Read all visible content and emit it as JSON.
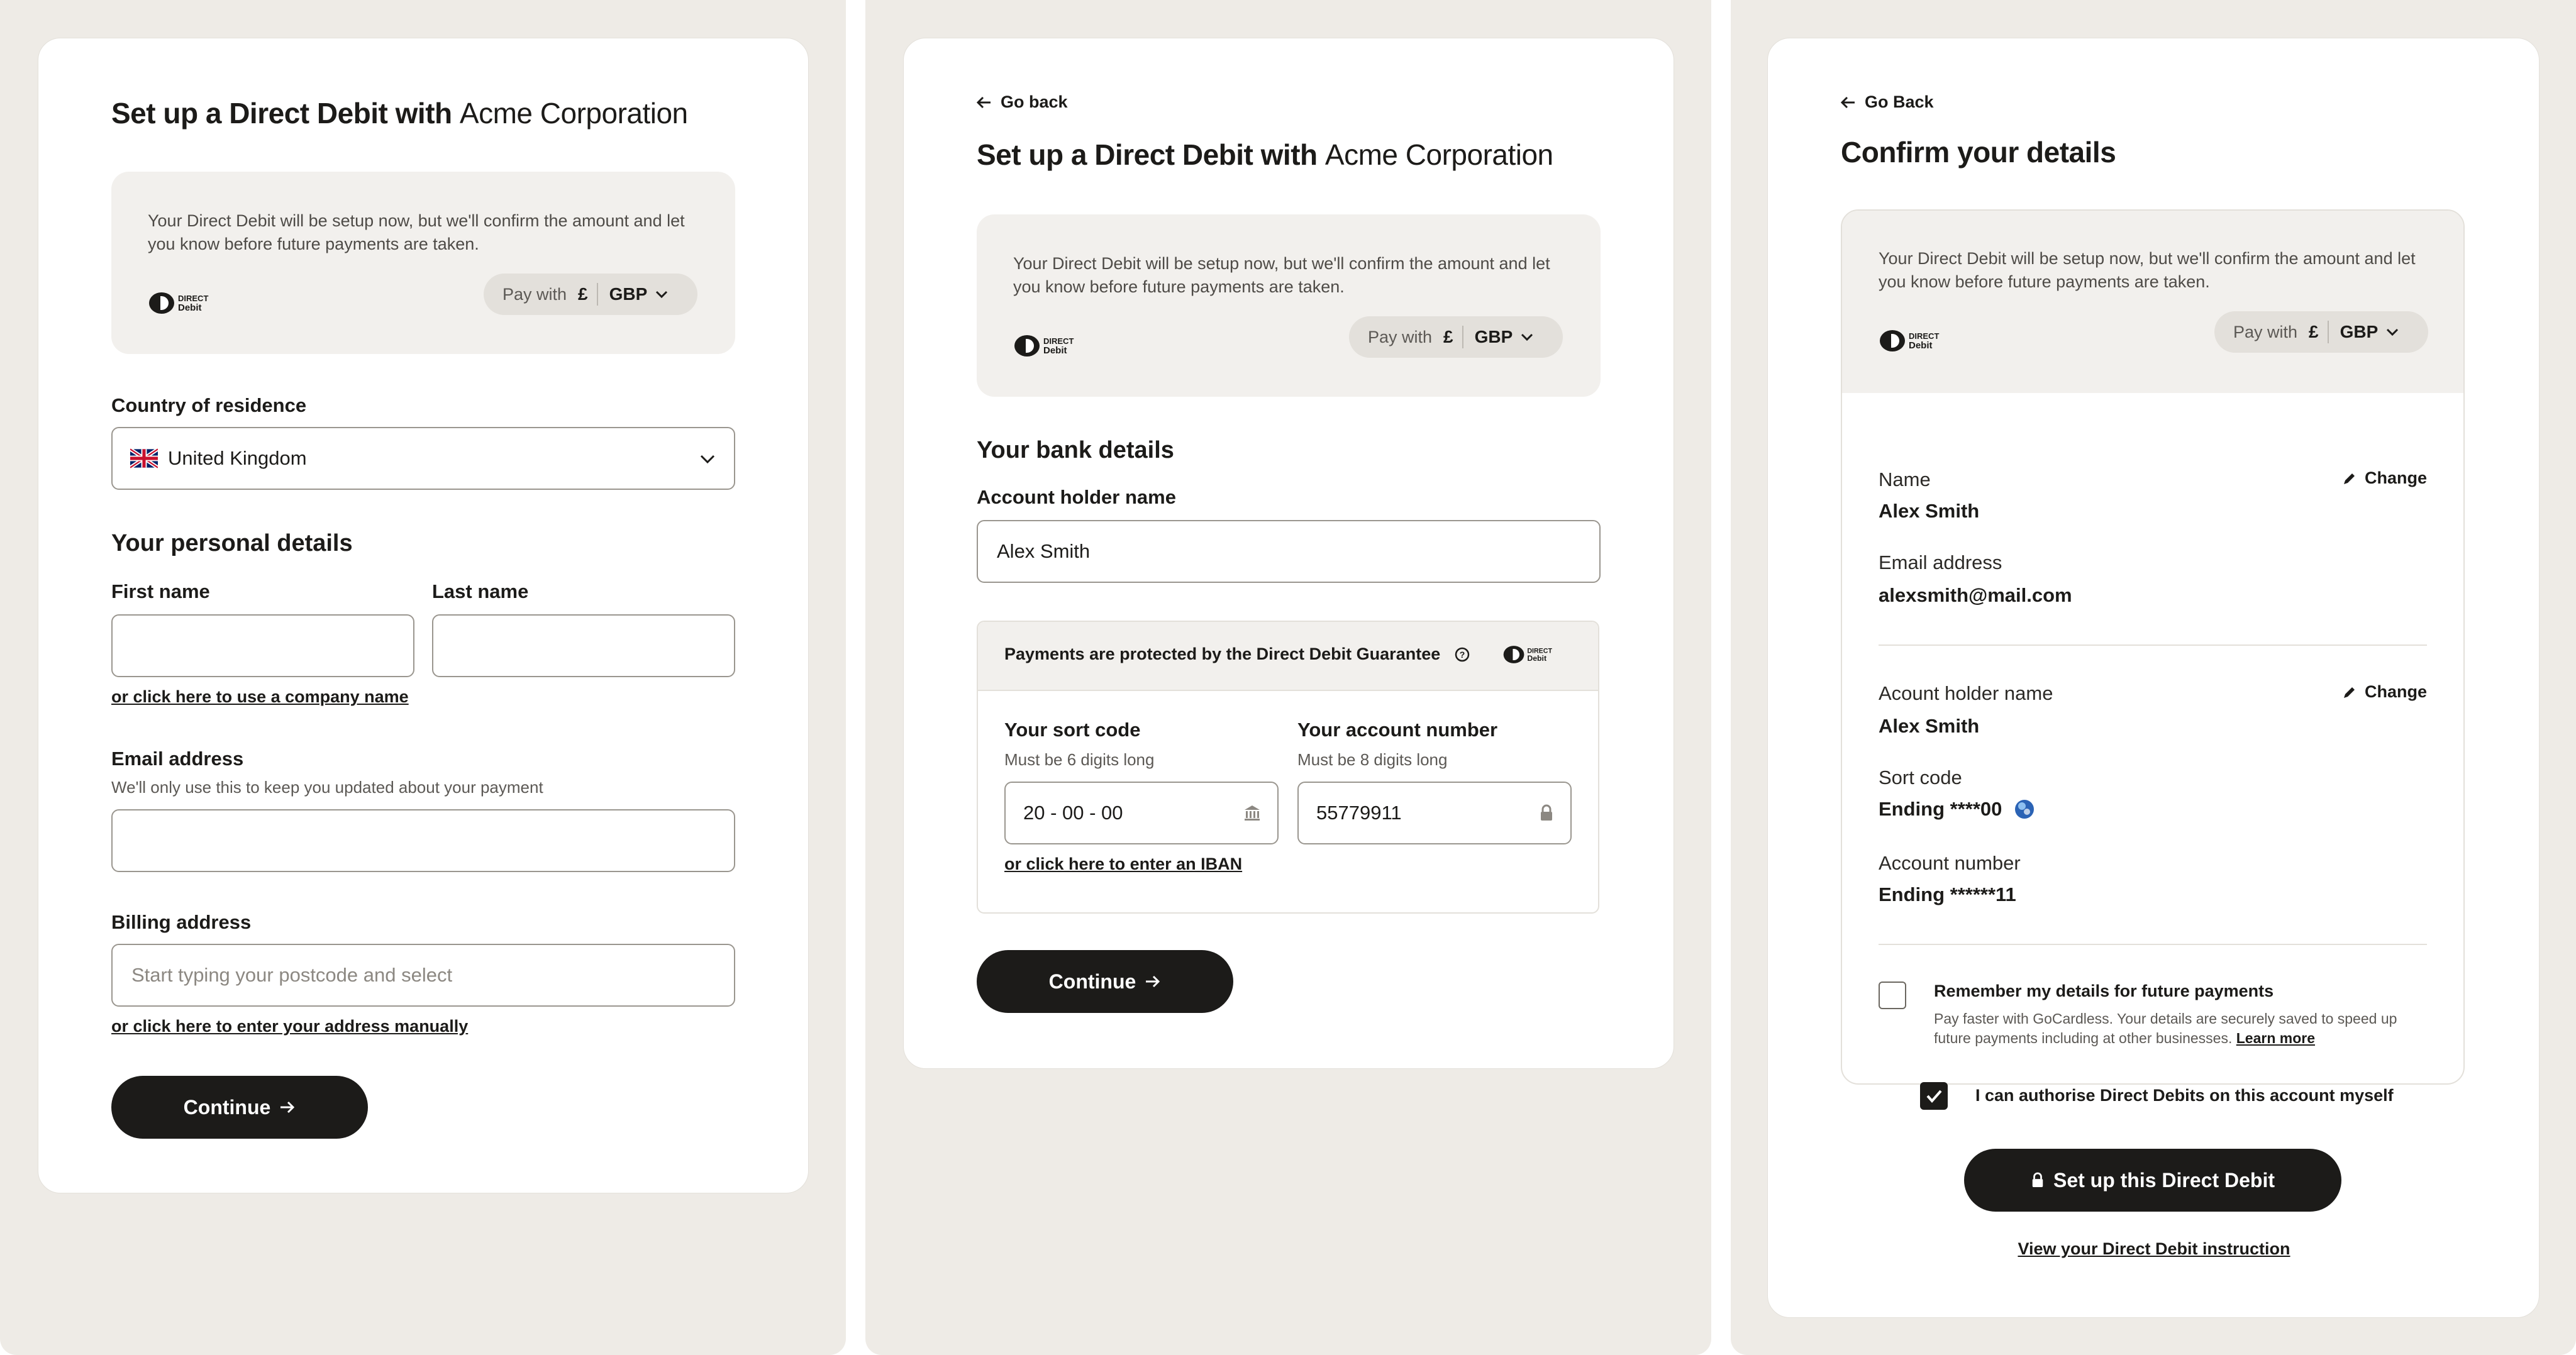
{
  "screens": {
    "personal": {
      "title_bold": "Set up a Direct Debit with",
      "title_merchant": "Acme Corporation",
      "info_text": "Your Direct Debit will be setup now, but we'll confirm the amount and let you know before future payments are taken.",
      "pay_with_label": "Pay with",
      "currency_symbol": "£",
      "currency_code": "GBP",
      "country_label": "Country of residence",
      "country_value": "United Kingdom",
      "section_title": "Your personal details",
      "first_name_label": "First name",
      "first_name_value": "",
      "last_name_label": "Last name",
      "last_name_value": "",
      "company_link": "or click here to use a company name",
      "email_label": "Email address",
      "email_hint": "We'll only use this to keep you updated about your payment",
      "email_value": "",
      "billing_label": "Billing address",
      "billing_placeholder": "Start typing your postcode and select",
      "manual_address_link": "or click here to enter your address manually",
      "continue_label": "Continue"
    },
    "bank": {
      "back_label": "Go back",
      "title_bold": "Set up a Direct Debit with",
      "title_merchant": "Acme Corporation",
      "info_text": "Your Direct Debit will be setup now, but we'll confirm the amount and let you know before future payments are taken.",
      "pay_with_label": "Pay with",
      "currency_symbol": "£",
      "currency_code": "GBP",
      "section_title": "Your bank details",
      "holder_label": "Account holder name",
      "holder_value": "Alex Smith",
      "guarantee_text": "Payments are protected by the Direct Debit Guarantee",
      "sort_code_label": "Your sort code",
      "sort_code_hint": "Must be 6 digits long",
      "sort_code_value": "20 - 00 - 00",
      "account_label": "Your account number",
      "account_hint": "Must be 8 digits long",
      "account_value": "55779911",
      "iban_link": "or click here to enter an IBAN",
      "continue_label": "Continue"
    },
    "confirm": {
      "back_label": "Go Back",
      "title": "Confirm your details",
      "info_text": "Your Direct Debit will be setup now, but we'll confirm the amount and let you know before future payments are taken.",
      "pay_with_label": "Pay with",
      "currency_symbol": "£",
      "currency_code": "GBP",
      "name_label": "Name",
      "name_value": "Alex Smith",
      "change_label": "Change",
      "email_label": "Email address",
      "email_value": "alexsmith@mail.com",
      "holder_label": "Acount holder name",
      "holder_value": "Alex Smith",
      "sort_code_label": "Sort code",
      "sort_code_value": "Ending ****00",
      "account_label": "Account number",
      "account_value": "Ending ******11",
      "remember_label": "Remember my details for future payments",
      "remember_desc": "Pay faster with GoCardless. Your details are securely saved to speed up future payments including at other businesses.",
      "learn_more": "Learn more",
      "remember_checked": false,
      "authorise_label": "I can authorise Direct Debits on this account myself",
      "authorise_checked": true,
      "submit_label": "Set up this Direct Debit",
      "view_instruction": "View your Direct Debit instruction"
    }
  },
  "colors": {
    "page_bg": "#eeebe6",
    "card_bg": "#ffffff",
    "info_bg": "#f2f0ed",
    "primary": "#1c1b19",
    "border": "#9a968f"
  }
}
